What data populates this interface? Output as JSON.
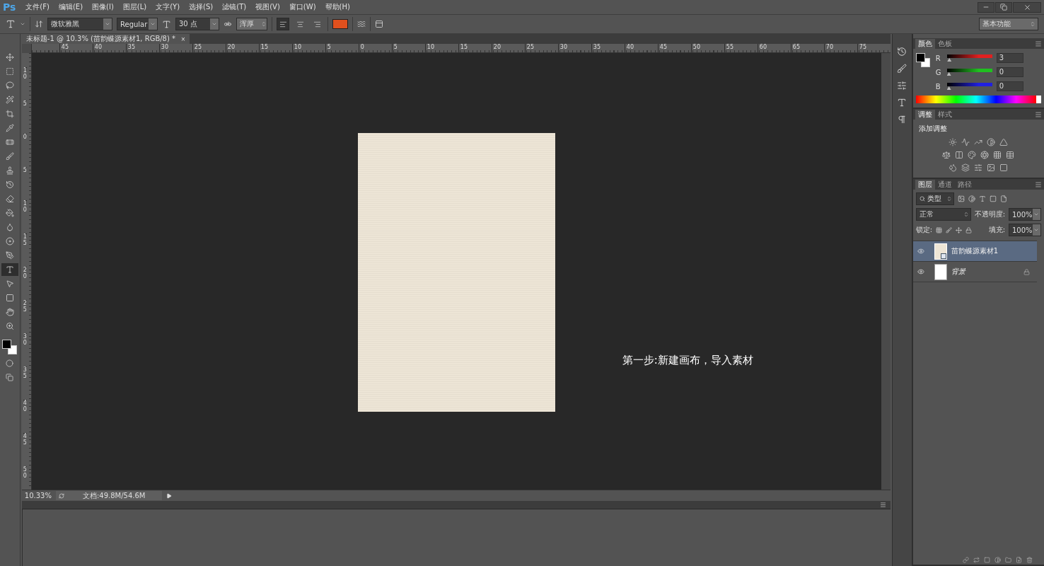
{
  "menu_bar": {
    "logo": "Ps",
    "items": [
      "文件(F)",
      "编辑(E)",
      "图像(I)",
      "图层(L)",
      "文字(Y)",
      "选择(S)",
      "滤镜(T)",
      "视图(V)",
      "窗口(W)",
      "帮助(H)"
    ]
  },
  "options_bar": {
    "font_family": "微软雅黑",
    "font_style": "Regular",
    "font_size": "30 点",
    "anti_alias": "浑厚",
    "align": [
      {
        "selected": true
      },
      {
        "selected": false
      },
      {
        "selected": false
      }
    ],
    "workspace": "基本功能"
  },
  "document_tab": {
    "title": "未标题-1 @ 10.3% (苗韵蝶源素材1, RGB/8) *",
    "close": "×"
  },
  "rulers": {
    "horizontal": [
      "45",
      "40",
      "35",
      "30",
      "25",
      "20",
      "15",
      "10",
      "5",
      "0",
      "5",
      "10",
      "15",
      "20",
      "25",
      "30",
      "35",
      "40",
      "45",
      "50",
      "55",
      "60",
      "65",
      "70",
      "75"
    ],
    "vertical": [
      "10",
      "5",
      "0",
      "5",
      "10",
      "15",
      "20",
      "25",
      "30",
      "35",
      "40",
      "45",
      "50"
    ]
  },
  "tools": [
    {
      "kind": "move",
      "selected": false
    },
    {
      "kind": "marquee",
      "selected": false
    },
    {
      "kind": "lasso",
      "selected": false
    },
    {
      "kind": "wand",
      "selected": false
    },
    {
      "kind": "crop",
      "selected": false
    },
    {
      "kind": "eyedropper",
      "selected": false
    },
    {
      "kind": "healing",
      "selected": false
    },
    {
      "kind": "brush",
      "selected": false
    },
    {
      "kind": "stamp",
      "selected": false
    },
    {
      "kind": "history",
      "selected": false
    },
    {
      "kind": "eraser",
      "selected": false
    },
    {
      "kind": "bucket",
      "selected": false
    },
    {
      "kind": "blur",
      "selected": false
    },
    {
      "kind": "dodge",
      "selected": false
    },
    {
      "kind": "pen",
      "selected": false
    },
    {
      "kind": "type",
      "selected": true
    },
    {
      "kind": "path",
      "selected": false
    },
    {
      "kind": "shape",
      "selected": false
    },
    {
      "kind": "hand",
      "selected": false
    },
    {
      "kind": "zoom",
      "selected": false
    }
  ],
  "canvas": {
    "caption": "第一步:新建画布，导入素材"
  },
  "status_bar": {
    "zoom": "10.33%",
    "doc_size": "文档:49.8M/54.6M"
  },
  "color_panel": {
    "tabs": [
      {
        "label": "颜色",
        "selected": true
      },
      {
        "label": "色板",
        "selected": false
      }
    ],
    "channels": [
      {
        "name": "R",
        "level": 0.01,
        "value": "3",
        "color": "#e02020"
      },
      {
        "name": "G",
        "level": 0,
        "value": "0",
        "color": "#20c020"
      },
      {
        "name": "B",
        "level": 0,
        "value": "0",
        "color": "#2020e0"
      }
    ]
  },
  "adjustments_panel": {
    "tabs": [
      {
        "label": "调整",
        "selected": true
      },
      {
        "label": "样式",
        "selected": false
      }
    ],
    "heading": "添加调整"
  },
  "layers_panel": {
    "tabs": [
      {
        "label": "图层",
        "selected": true
      },
      {
        "label": "通道",
        "selected": false
      },
      {
        "label": "路径",
        "selected": false
      }
    ],
    "filter": "类型",
    "blend_mode": "正常",
    "opacity_label": "不透明度:",
    "opacity": "100%",
    "lock_label": "锁定:",
    "fill_label": "填充:",
    "fill": "100%",
    "layers": [
      {
        "name": "苗韵蝶源素材1",
        "kind": "smart_object",
        "selected": true,
        "visible": true,
        "locked": false
      },
      {
        "name": "背景",
        "kind": "background",
        "selected": false,
        "visible": true,
        "locked": true
      }
    ]
  }
}
